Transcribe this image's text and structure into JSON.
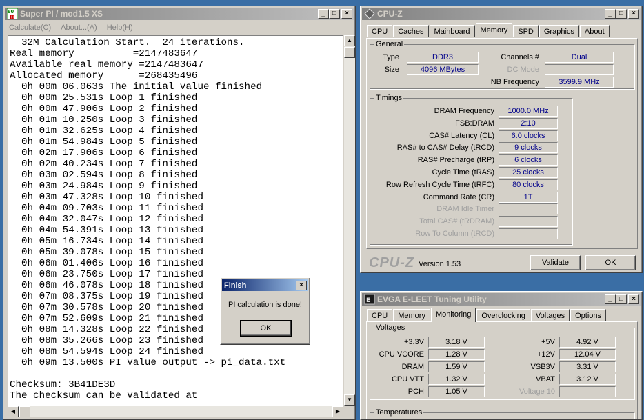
{
  "superpi": {
    "title": "Super PI / mod1.5 XS",
    "menu": [
      "Calculate(C)",
      "About...(A)",
      "Help(H)"
    ],
    "log": [
      "  32M Calculation Start.  24 iterations.",
      "Real memory          =2147483647",
      "Available real memory =2147483647",
      "Allocated memory      =268435496",
      "  0h 00m 06.063s The initial value finished",
      "  0h 00m 25.531s Loop 1 finished",
      "  0h 00m 47.906s Loop 2 finished",
      "  0h 01m 10.250s Loop 3 finished",
      "  0h 01m 32.625s Loop 4 finished",
      "  0h 01m 54.984s Loop 5 finished",
      "  0h 02m 17.906s Loop 6 finished",
      "  0h 02m 40.234s Loop 7 finished",
      "  0h 03m 02.594s Loop 8 finished",
      "  0h 03m 24.984s Loop 9 finished",
      "  0h 03m 47.328s Loop 10 finished",
      "  0h 04m 09.703s Loop 11 finished",
      "  0h 04m 32.047s Loop 12 finished",
      "  0h 04m 54.391s Loop 13 finished",
      "  0h 05m 16.734s Loop 14 finished",
      "  0h 05m 39.078s Loop 15 finished",
      "  0h 06m 01.406s Loop 16 finished",
      "  0h 06m 23.750s Loop 17 finished",
      "  0h 06m 46.078s Loop 18 finished",
      "  0h 07m 08.375s Loop 19 finished",
      "  0h 07m 30.578s Loop 20 finished",
      "  0h 07m 52.609s Loop 21 finished",
      "  0h 08m 14.328s Loop 22 finished",
      "  0h 08m 35.266s Loop 23 finished",
      "  0h 08m 54.594s Loop 24 finished",
      "  0h 09m 13.500s PI value output -> pi_data.txt",
      "",
      "Checksum: 3B41DE3D",
      "The checksum can be validated at"
    ]
  },
  "finish_dialog": {
    "title": "Finish",
    "message": "PI calculation is done!",
    "ok_label": "OK"
  },
  "cpuz": {
    "title": "CPU-Z",
    "tabs": [
      "CPU",
      "Caches",
      "Mainboard",
      "Memory",
      "SPD",
      "Graphics",
      "About"
    ],
    "selected_tab": "Memory",
    "general": {
      "group_label": "General",
      "type_label": "Type",
      "type_value": "DDR3",
      "size_label": "Size",
      "size_value": "4096 MBytes",
      "channels_label": "Channels #",
      "channels_value": "Dual",
      "dcmode_label": "DC Mode",
      "dcmode_value": "",
      "nbfreq_label": "NB Frequency",
      "nbfreq_value": "3599.9 MHz"
    },
    "timings": {
      "group_label": "Timings",
      "rows": [
        {
          "label": "DRAM Frequency",
          "value": "1000.0 MHz",
          "enabled": true
        },
        {
          "label": "FSB:DRAM",
          "value": "2:10",
          "enabled": true
        },
        {
          "label": "CAS# Latency (CL)",
          "value": "6.0 clocks",
          "enabled": true
        },
        {
          "label": "RAS# to CAS# Delay (tRCD)",
          "value": "9 clocks",
          "enabled": true
        },
        {
          "label": "RAS# Precharge (tRP)",
          "value": "6 clocks",
          "enabled": true
        },
        {
          "label": "Cycle Time (tRAS)",
          "value": "25 clocks",
          "enabled": true
        },
        {
          "label": "Row Refresh Cycle Time (tRFC)",
          "value": "80 clocks",
          "enabled": true
        },
        {
          "label": "Command Rate (CR)",
          "value": "1T",
          "enabled": true
        },
        {
          "label": "DRAM Idle Timer",
          "value": "",
          "enabled": false
        },
        {
          "label": "Total CAS# (tRDRAM)",
          "value": "",
          "enabled": false
        },
        {
          "label": "Row To Column (tRCD)",
          "value": "",
          "enabled": false
        }
      ]
    },
    "brand": "CPU-Z",
    "version": "Version 1.53",
    "validate_label": "Validate",
    "ok_label": "OK"
  },
  "evga": {
    "title": "EVGA E-LEET Tuning Utility",
    "tabs": [
      "CPU",
      "Memory",
      "Monitoring",
      "Overclocking",
      "Voltages",
      "Options"
    ],
    "selected_tab": "Monitoring",
    "voltages_label": "Voltages",
    "left": [
      {
        "label": "+3.3V",
        "value": "3.18 V"
      },
      {
        "label": "CPU VCORE",
        "value": "1.28 V"
      },
      {
        "label": "DRAM",
        "value": "1.59 V"
      },
      {
        "label": "CPU VTT",
        "value": "1.32 V"
      },
      {
        "label": "PCH",
        "value": "1.05 V"
      }
    ],
    "right": [
      {
        "label": "+5V",
        "value": "4.92 V",
        "enabled": true
      },
      {
        "label": "+12V",
        "value": "12.04 V",
        "enabled": true
      },
      {
        "label": "VSB3V",
        "value": "3.31 V",
        "enabled": true
      },
      {
        "label": "VBAT",
        "value": "3.12 V",
        "enabled": true
      },
      {
        "label": "Voltage 10",
        "value": "",
        "enabled": false
      }
    ],
    "temperatures_label": "Temperatures"
  }
}
